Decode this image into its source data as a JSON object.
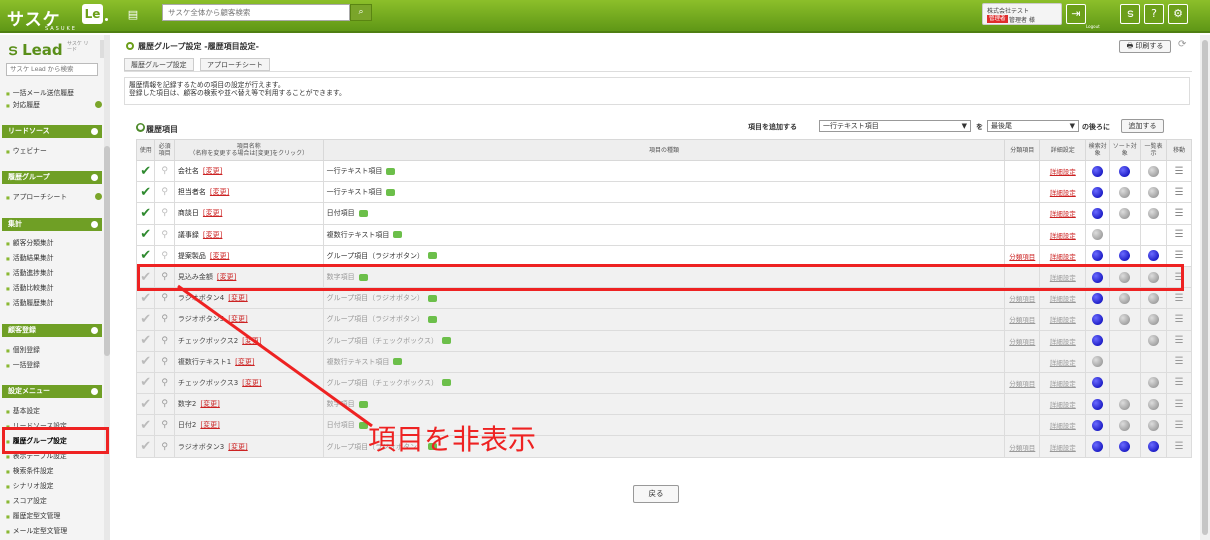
{
  "header": {
    "logo": "サスケ",
    "logo_sub": "SASUKE",
    "le_badge": "Le",
    "search_placeholder": "サスケ全体から顧客検索",
    "company": "株式会社テスト",
    "role_badge": "管理者",
    "user_name": "管理者 様",
    "logout_label": "Logout",
    "icons": [
      "calendar-icon",
      "search-icon",
      "logout-icon",
      "sasuke-icon",
      "help-icon",
      "gear-icon"
    ]
  },
  "sidebar": {
    "title": "Lead",
    "title_sub": "サスケ リード",
    "search_placeholder": "サスケ Lead から検索",
    "items_top": [
      "一括メール送信履歴",
      "対応履歴"
    ],
    "sections": [
      {
        "title": "リードソース",
        "items": [
          "ウェビナー"
        ]
      },
      {
        "title": "履歴グループ",
        "items": [
          "アプローチシート"
        ]
      },
      {
        "title": "集計",
        "items": [
          "顧客分類集計",
          "活動結果集計",
          "活動進捗集計",
          "活動比較集計",
          "活動履歴集計"
        ]
      },
      {
        "title": "顧客登録",
        "items": [
          "個別登録",
          "一括登録"
        ]
      },
      {
        "title": "設定メニュー",
        "items": [
          "基本設定",
          "リードソース設定",
          "履歴グループ設定",
          "表示テーブル設定",
          "検索条件設定",
          "シナリオ設定",
          "スコア設定",
          "履歴定型文管理",
          "メール定型文管理"
        ]
      }
    ]
  },
  "main": {
    "page_title": "履歴グループ設定 -履歴項目設定-",
    "print_label": "印刷する",
    "breadcrumbs": [
      "履歴グループ設定",
      "アプローチシート"
    ],
    "info_line1": "履歴情報を記録するための項目の設定が行えます。",
    "info_line2": "登録した項目は、顧客の検索や並べ替え等で利用することができます。",
    "section_title": "履歴項目",
    "add_label": "項目を追加する",
    "add_type_value": "一行テキスト項目",
    "wo_label": "を",
    "position_value": "最後尾",
    "after_label": "の後ろに",
    "add_button": "追加する",
    "back_button": "戻る"
  },
  "table": {
    "headers": {
      "use": "使用",
      "required": "必須項目",
      "name": "項目名称",
      "name_note": "（名称を変更する場合は[変更]をクリック）",
      "type": "項目の種類",
      "class": "分類項目",
      "detail": "詳細設定",
      "search": "検索対象",
      "sort": "ソート対象",
      "list": "一覧表示",
      "move": "移動"
    },
    "change_label": "[変更]",
    "class_link": "分類項目",
    "detail_link": "詳細設定",
    "rows": [
      {
        "name": "会社名",
        "type": "一行テキスト項目",
        "used": true,
        "class": false,
        "search": "blue",
        "sort": "blue",
        "list": "grey"
      },
      {
        "name": "担当者名",
        "type": "一行テキスト項目",
        "used": true,
        "class": false,
        "search": "blue",
        "sort": "grey",
        "list": "grey"
      },
      {
        "name": "商談日",
        "type": "日付項目",
        "used": true,
        "class": false,
        "search": "blue",
        "sort": "grey",
        "list": "grey"
      },
      {
        "name": "議事録",
        "type": "複数行テキスト項目",
        "used": true,
        "class": false,
        "search": "grey",
        "sort": "",
        "list": ""
      },
      {
        "name": "提案製品",
        "type": "グループ項目（ラジオボタン）",
        "used": true,
        "class": true,
        "search": "blue",
        "sort": "blue",
        "list": "blue"
      },
      {
        "name": "見込み金額",
        "type": "数字項目",
        "used": false,
        "class": false,
        "search": "blue",
        "sort": "grey",
        "list": "grey"
      },
      {
        "name": "ラジオボタン4",
        "type": "グループ項目（ラジオボタン）",
        "used": false,
        "class": true,
        "search": "blue",
        "sort": "grey",
        "list": "grey"
      },
      {
        "name": "ラジオボタン5",
        "type": "グループ項目（ラジオボタン）",
        "used": false,
        "class": true,
        "search": "blue",
        "sort": "grey",
        "list": "grey"
      },
      {
        "name": "チェックボックス2",
        "type": "グループ項目（チェックボックス）",
        "used": false,
        "class": true,
        "search": "blue",
        "sort": "",
        "list": "grey"
      },
      {
        "name": "複数行テキスト1",
        "type": "複数行テキスト項目",
        "used": false,
        "class": false,
        "search": "grey",
        "sort": "",
        "list": ""
      },
      {
        "name": "チェックボックス3",
        "type": "グループ項目（チェックボックス）",
        "used": false,
        "class": true,
        "search": "blue",
        "sort": "",
        "list": "grey"
      },
      {
        "name": "数字2",
        "type": "数字項目",
        "used": false,
        "class": false,
        "search": "blue",
        "sort": "grey",
        "list": "grey"
      },
      {
        "name": "日付2",
        "type": "日付項目",
        "used": false,
        "class": false,
        "search": "blue",
        "sort": "grey",
        "list": "grey"
      },
      {
        "name": "ラジオボタン3",
        "type": "グループ項目（ラジオボタン）",
        "used": false,
        "class": true,
        "search": "blue",
        "sort": "blue",
        "list": "blue"
      }
    ]
  },
  "annotation": {
    "text": "項目を非表示",
    "color": "#e22222"
  }
}
